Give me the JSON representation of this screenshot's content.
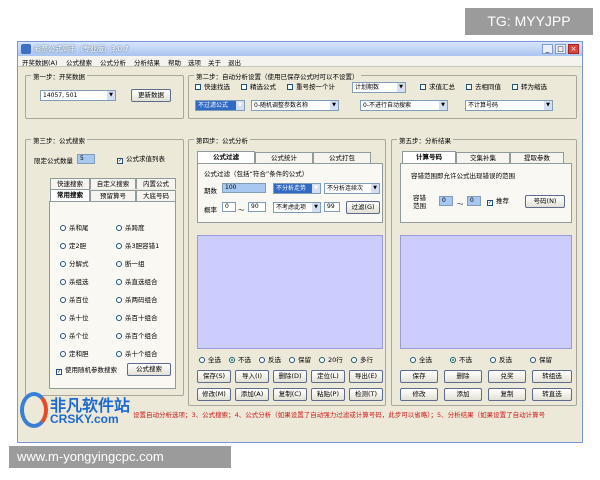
{
  "overlay": {
    "tg_badge": "TG: MYYJPP",
    "url": "www.m-yongyingcpc.com",
    "watermark_cn": "非凡软件站",
    "watermark_en": "CRSKY.com"
  },
  "window": {
    "title": "彩票公式高手（专业版）3.0.7",
    "controls": {
      "minimize": "_",
      "maximize": "□",
      "close": "×"
    }
  },
  "menu": [
    "开奖数据(A)",
    "公式搜索",
    "公式分析",
    "分析结果",
    "帮助",
    "选项",
    "关于",
    "退出"
  ],
  "step1": {
    "title": "第一步：开奖数据",
    "period_value": "14057, 501",
    "update_button": "更新数据"
  },
  "step2": {
    "title": "第二步：自动分析设置（使用已保存公式时可以不设置）",
    "checks": [
      {
        "label": "快速找选",
        "checked": false
      },
      {
        "label": "精选公式",
        "checked": false
      },
      {
        "label": "重号按一个计",
        "checked": false
      },
      {
        "label": "求值汇总",
        "checked": false
      },
      {
        "label": "去相同值",
        "checked": false
      },
      {
        "label": "转为缩选",
        "checked": false
      }
    ],
    "combo_top": "计划期数",
    "combos": [
      "不过滤公式",
      "0-随机调整参数名称",
      "0-不进行自动搜索",
      "不计算号码"
    ]
  },
  "step3": {
    "title": "第三步：公式搜索",
    "limit_label": "限定公式数量",
    "limit_value": "5",
    "show_list_label": "公式求值列表",
    "show_list_checked": true,
    "tabs_row1": [
      "快速搜索",
      "自定义搜索",
      "内置公式"
    ],
    "tabs_row2": [
      "常用搜索",
      "预留算号",
      "大底号码"
    ],
    "methods_left": [
      "杀和尾",
      "定2胆",
      "分解式",
      "杀组选",
      "杀百位",
      "杀十位",
      "杀个位",
      "定和胆"
    ],
    "methods_right": [
      "杀跨度",
      "杀3胆容错1",
      "断一组",
      "杀直选组合",
      "杀两码组合",
      "杀百十组合",
      "杀百个组合",
      "杀十个组合"
    ],
    "random_label": "使用随机参数搜索",
    "random_checked": true,
    "search_button": "公式搜索"
  },
  "step4": {
    "title": "第四步：公式分析",
    "tabs": [
      "公式过滤",
      "公式统计",
      "公式打包"
    ],
    "filter_title": "公式过滤（包括“符合”条件的公式）",
    "period_label": "期数",
    "period_value": "100",
    "period_combo": "不分析走势",
    "period_combo2": "不分析连续次",
    "rate_label": "概率",
    "rate_min": "0",
    "rate_tilde": "〜",
    "rate_max": "90",
    "rate_combo": "不考虑此项",
    "rate_value": "99",
    "filter_button": "过滤(G)",
    "radios": [
      {
        "label": "全选",
        "on": false
      },
      {
        "label": "不选",
        "on": true
      },
      {
        "label": "反选",
        "on": false
      },
      {
        "label": "保留",
        "on": false
      },
      {
        "label": "20行",
        "on": false
      },
      {
        "label": "多行",
        "on": false
      }
    ],
    "buttons_row1": [
      "保存(S)",
      "导入(I)",
      "删除(D)",
      "定位(L)",
      "导出(E)"
    ],
    "buttons_row2": [
      "修改(M)",
      "添加(A)",
      "复制(C)",
      "粘贴(P)",
      "检测(T)"
    ]
  },
  "step5": {
    "title": "第五步：分析结果",
    "tabs": [
      "计算号码",
      "交集补集",
      "提取参数"
    ],
    "range_title": "容错范围即允许公式出现错误的范围",
    "range_label": "容错\n范围",
    "range_min": "0",
    "range_tilde": "〜",
    "range_max": "0",
    "recommend_label": "推荐",
    "recommend_checked": true,
    "number_button": "号码(N)",
    "radios": [
      {
        "label": "全选",
        "on": false
      },
      {
        "label": "不选",
        "on": true
      },
      {
        "label": "反选",
        "on": false
      },
      {
        "label": "保留",
        "on": false
      }
    ],
    "buttons_row1": [
      "保存",
      "删除",
      "兑奖",
      "转组选"
    ],
    "buttons_row2": [
      "修改",
      "添加",
      "复制",
      "转直选"
    ]
  },
  "status": "设置自动分析选项；3、公式搜索；4、公式分析（如果设置了自动强力过滤或计算号码，此步可以省略）；5、分析结果（如果设置了自动计算号"
}
